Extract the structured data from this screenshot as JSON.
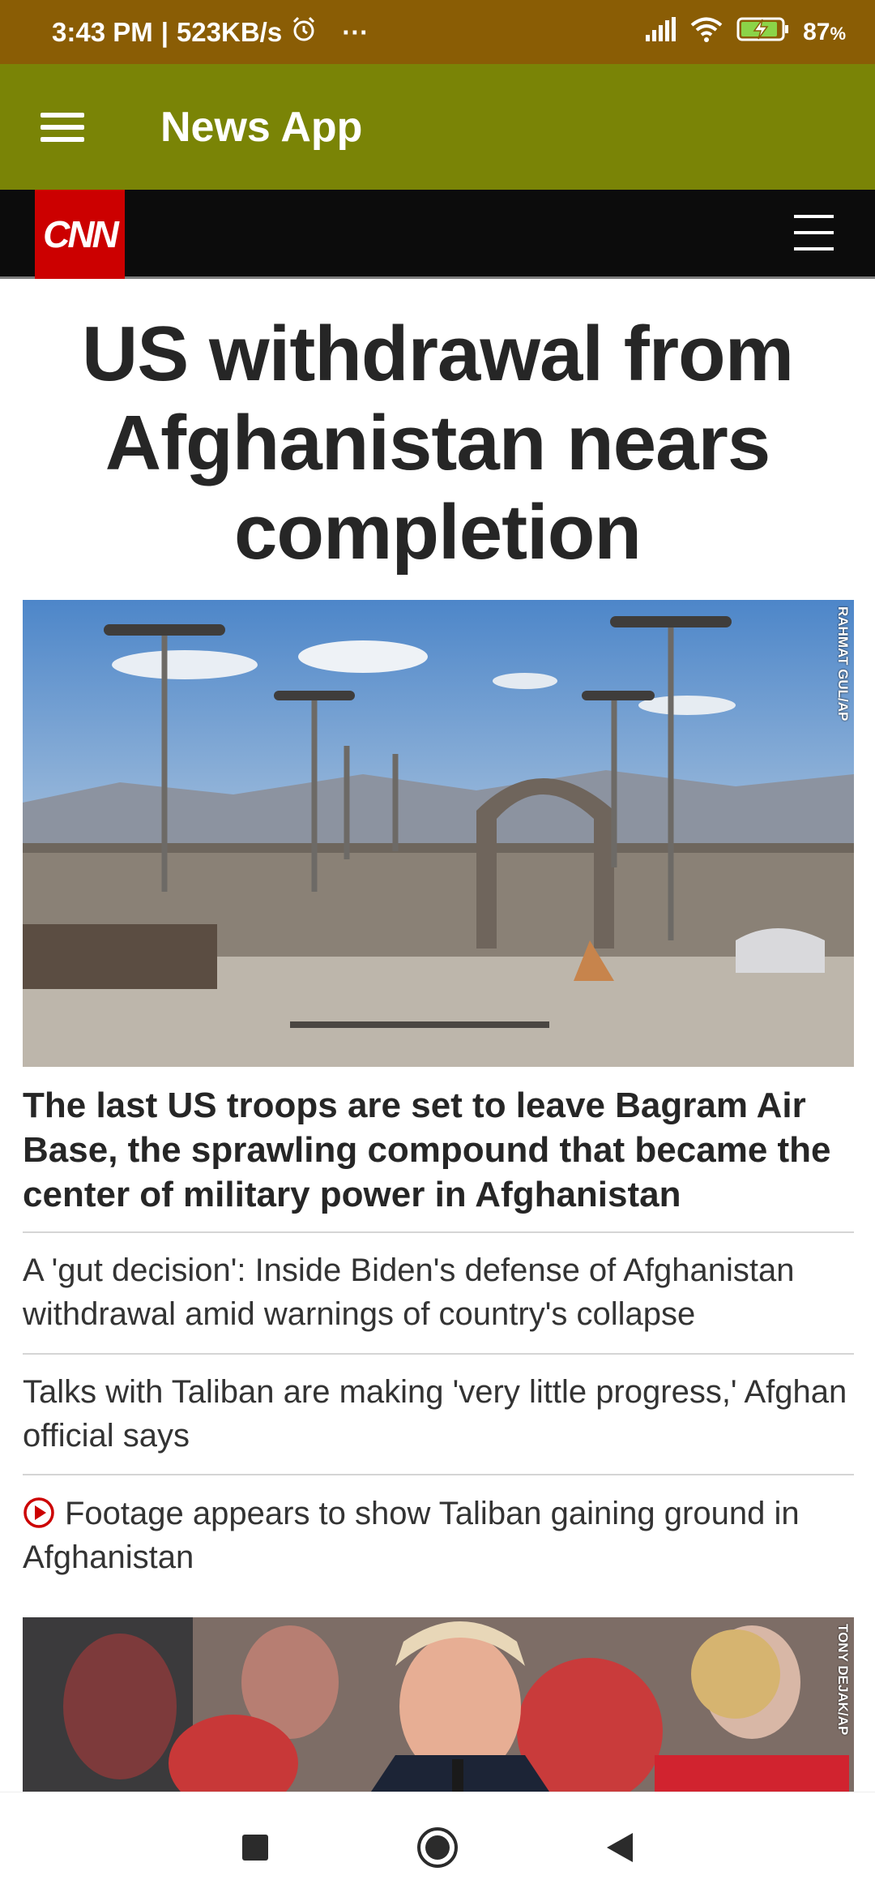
{
  "status_bar": {
    "time": "3:43 PM",
    "speed": "523KB/s",
    "dots": "···",
    "battery": "87",
    "battery_unit": "%"
  },
  "app_bar": {
    "title": "News App"
  },
  "cnn": {
    "logo_text": "CNN"
  },
  "article": {
    "headline": "US withdrawal from Afghanistan nears completion",
    "photo1_credit": "RAHMAT GUL/AP",
    "lead": "The last US troops are set to leave Bagram Air Base, the sprawling compound that became the center of military power in Afghanistan",
    "items": [
      "A 'gut decision': Inside Biden's defense of Afghanistan withdrawal amid warnings of country's collapse",
      "Talks with Taliban are making 'very little progress,' Afghan official says",
      "Footage appears to show Taliban gaining ground in Afghanistan"
    ],
    "photo2_credit": "TONY DEJAK/AP"
  },
  "colors": {
    "status_bar": "#8a5d05",
    "app_bar": "#7a8406",
    "cnn_red": "#cc0000",
    "cnn_header": "#0c0c0c"
  },
  "icons": {
    "menu": "hamburger-icon",
    "alarm": "alarm-icon",
    "signal": "signal-icon",
    "wifi": "wifi-icon",
    "battery": "battery-charging-icon",
    "play": "play-icon",
    "nav": [
      "square-recents-icon",
      "circle-home-icon",
      "triangle-back-icon"
    ]
  }
}
